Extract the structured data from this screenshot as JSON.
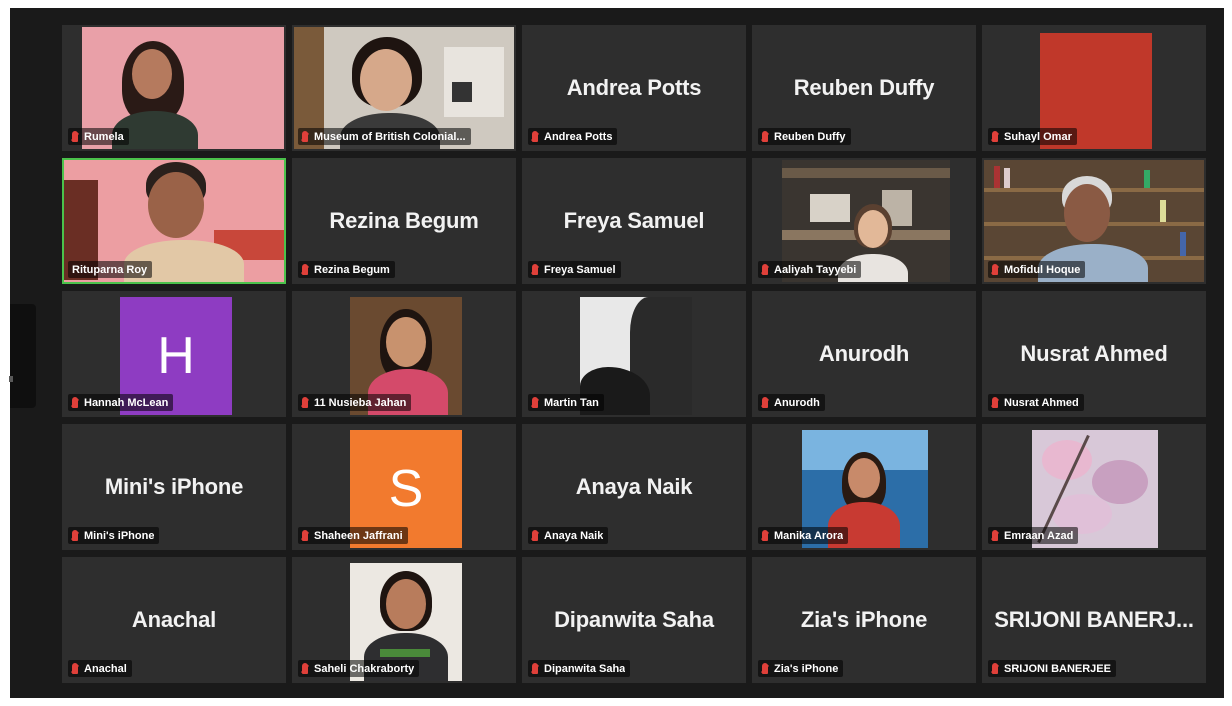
{
  "participants": [
    {
      "label": "Rumela",
      "center": "",
      "type": "video"
    },
    {
      "label": "Museum of British Colonial...",
      "center": "",
      "type": "video"
    },
    {
      "label": "Andrea Potts",
      "center": "Andrea Potts",
      "type": "name"
    },
    {
      "label": "Reuben Duffy",
      "center": "Reuben Duffy",
      "type": "name"
    },
    {
      "label": "Suhayl Omar",
      "center": "",
      "type": "color"
    },
    {
      "label": "Rituparna Roy",
      "center": "",
      "type": "video",
      "speaking": true
    },
    {
      "label": "Rezina Begum",
      "center": "Rezina Begum",
      "type": "name"
    },
    {
      "label": "Freya Samuel",
      "center": "Freya Samuel",
      "type": "name"
    },
    {
      "label": "Aaliyah Tayyebi",
      "center": "",
      "type": "video"
    },
    {
      "label": "Mofidul Hoque",
      "center": "",
      "type": "video"
    },
    {
      "label": "Hannah McLean",
      "center": "",
      "type": "avatar",
      "initial": "H"
    },
    {
      "label": "11 Nusieba Jahan",
      "center": "",
      "type": "video"
    },
    {
      "label": "Martin Tan",
      "center": "",
      "type": "video"
    },
    {
      "label": "Anurodh",
      "center": "Anurodh",
      "type": "name"
    },
    {
      "label": "Nusrat Ahmed",
      "center": "Nusrat Ahmed",
      "type": "name"
    },
    {
      "label": "Mini's iPhone",
      "center": "Mini's iPhone",
      "type": "name"
    },
    {
      "label": "Shaheen Jaffrani",
      "center": "",
      "type": "avatar",
      "initial": "S"
    },
    {
      "label": "Anaya Naik",
      "center": "Anaya Naik",
      "type": "name"
    },
    {
      "label": "Manika Arora",
      "center": "",
      "type": "video"
    },
    {
      "label": "Emraan Azad",
      "center": "",
      "type": "video"
    },
    {
      "label": "Anachal",
      "center": "Anachal",
      "type": "name"
    },
    {
      "label": "Saheli Chakraborty",
      "center": "",
      "type": "video"
    },
    {
      "label": "Dipanwita Saha",
      "center": "Dipanwita Saha",
      "type": "name"
    },
    {
      "label": "Zia's iPhone",
      "center": "Zia's iPhone",
      "type": "name"
    },
    {
      "label": "SRIJONI BANERJEE",
      "center": "SRIJONI BANERJ...",
      "type": "name"
    }
  ],
  "icons": {
    "muted": "microphone-muted-icon"
  },
  "colors": {
    "speaking_border": "#4bc24b",
    "muted": "#e0403a",
    "hannah_avatar": "#8e3cc2",
    "shaheen_avatar": "#f27a2e",
    "suhayl_block": "#c0382a"
  }
}
